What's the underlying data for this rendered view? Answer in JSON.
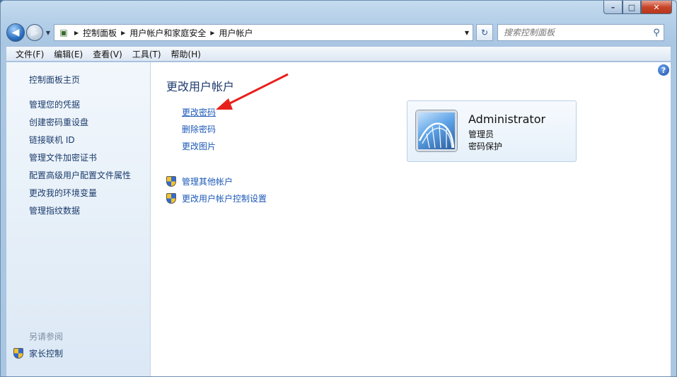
{
  "window": {
    "minimize_symbol": "–",
    "maximize_symbol": "□",
    "close_symbol": "✕"
  },
  "address": {
    "crumbs": [
      "控制面板",
      "用户帐户和家庭安全",
      "用户帐户"
    ],
    "search_placeholder": "搜索控制面板"
  },
  "menu": {
    "items": [
      "文件(F)",
      "编辑(E)",
      "查看(V)",
      "工具(T)",
      "帮助(H)"
    ]
  },
  "sidebar": {
    "items": [
      "控制面板主页",
      "管理您的凭据",
      "创建密码重设盘",
      "链接联机 ID",
      "管理文件加密证书",
      "配置高级用户配置文件属性",
      "更改我的环境变量",
      "管理指纹数据"
    ],
    "see_also_label": "另请参阅",
    "parental_controls": "家长控制"
  },
  "main": {
    "title": "更改用户帐户",
    "tasks": [
      "更改密码",
      "删除密码",
      "更改图片"
    ],
    "shield_tasks": [
      "管理其他帐户",
      "更改用户帐户控制设置"
    ],
    "help_symbol": "?"
  },
  "user": {
    "name": "Administrator",
    "role": "管理员",
    "status": "密码保护"
  },
  "colors": {
    "link": "#1d5ab8",
    "sidebar_link": "#1b3b6b",
    "annotation_arrow": "#e8201c"
  }
}
